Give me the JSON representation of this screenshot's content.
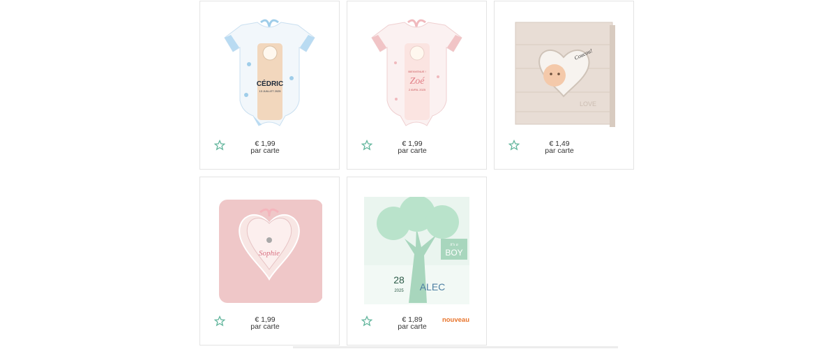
{
  "products": [
    {
      "image": "blue-bodysuit-card-image",
      "price": "€ 1,99",
      "unit": "par carte",
      "badge": ""
    },
    {
      "image": "pink-bodysuit-card-image",
      "price": "€ 1,99",
      "unit": "par carte",
      "badge": ""
    },
    {
      "image": "wood-heart-baby-card-image",
      "price": "€ 1,49",
      "unit": "par carte",
      "badge": ""
    },
    {
      "image": "pink-heart-ribbon-card-image",
      "price": "€ 1,99",
      "unit": "par carte",
      "badge": ""
    },
    {
      "image": "green-tree-card-image",
      "price": "€ 1,89",
      "unit": "par carte",
      "badge": "nouveau"
    }
  ],
  "artwork": {
    "card1_name": "CÉDRIC",
    "card1_date": "13 JUILLET 2025",
    "card2_greeting": "BIENVENUE !",
    "card2_name": "Zoé",
    "card2_date": "2 AVRIL 2025",
    "card3_text": "Coucou!",
    "card3_love": "LOVE",
    "card4_name": "Sophie",
    "card5_day": "28",
    "card5_name": "ALEC",
    "card5_boy": "BOY",
    "card5_small": "it's a",
    "card5_year": "2025"
  },
  "colors": {
    "star": "#62b59c",
    "badge": "#e8742b",
    "border": "#e3e3e3"
  }
}
